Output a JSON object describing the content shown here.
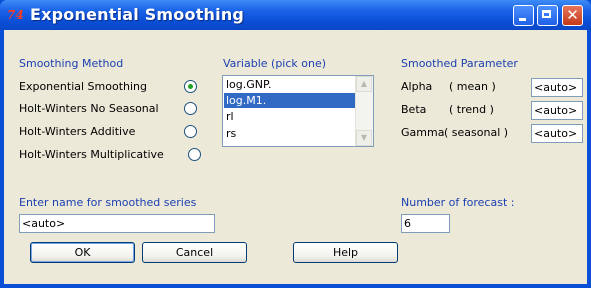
{
  "window": {
    "title": "Exponential Smoothing",
    "app_icon": "74",
    "close_glyph": "✕"
  },
  "smoothing_method": {
    "header": "Smoothing Method",
    "options": [
      {
        "label": "Exponential Smoothing",
        "selected": true
      },
      {
        "label": "Holt-Winters No Seasonal",
        "selected": false
      },
      {
        "label": "Holt-Winters Additive",
        "selected": false
      },
      {
        "label": "Holt-Winters Multiplicative",
        "selected": false
      }
    ]
  },
  "variable": {
    "header": "Variable (pick one)",
    "items": [
      "log.GNP.",
      "log.M1.",
      "rl",
      "rs"
    ],
    "selected": "log.M1.",
    "scroll_up": "▲",
    "scroll_down": "▼"
  },
  "smoothed_parameter": {
    "header": "Smoothed Parameter",
    "alpha": {
      "label": "Alpha",
      "desc": "( mean )",
      "value": "<auto>"
    },
    "beta": {
      "label": "Beta",
      "desc": "( trend )",
      "value": "<auto>"
    },
    "gamma": {
      "label": "Gamma",
      "desc": "( seasonal )",
      "value": "<auto>"
    }
  },
  "series_name": {
    "label": "Enter name for smoothed series",
    "value": "<auto>"
  },
  "forecast": {
    "label": "Number of forecast :",
    "value": "6"
  },
  "buttons": {
    "ok": "OK",
    "cancel": "Cancel",
    "help": "Help"
  },
  "colors": {
    "title_bar": "#0a4fd8",
    "client_bg": "#ece9d8",
    "section_header": "#1c3fb0",
    "selection": "#316ac5",
    "radio_dot": "#21a121"
  }
}
